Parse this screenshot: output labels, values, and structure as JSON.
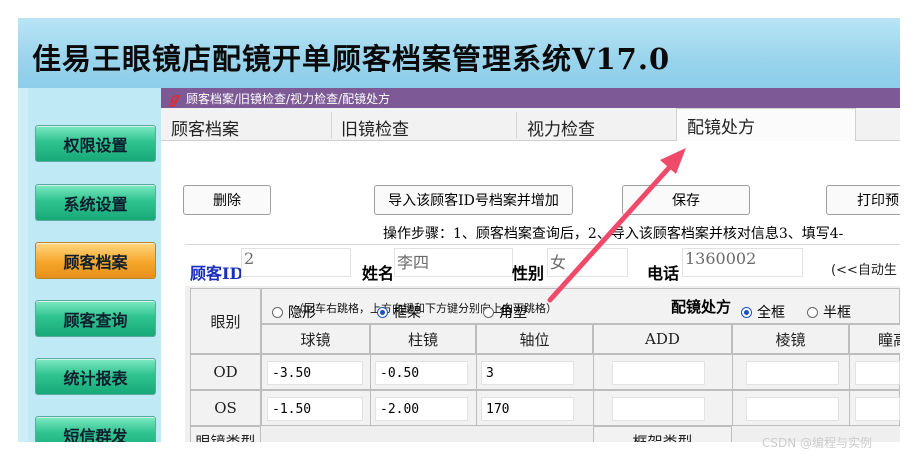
{
  "app": {
    "title": "佳易王眼镜店配镜开单顾客档案管理系统V17.0"
  },
  "sidebar": {
    "items": [
      {
        "label": "权限设置",
        "active": false
      },
      {
        "label": "系统设置",
        "active": false
      },
      {
        "label": "顾客档案",
        "active": true
      },
      {
        "label": "顾客查询",
        "active": false
      },
      {
        "label": "统计报表",
        "active": false
      },
      {
        "label": "短信群发",
        "active": false
      }
    ]
  },
  "window": {
    "title": "顾客档案/旧镜检查/视力检查/配镜处方"
  },
  "tabs": [
    {
      "label": "顾客档案"
    },
    {
      "label": "旧镜检查"
    },
    {
      "label": "视力检查"
    },
    {
      "label": "配镜处方",
      "active": true
    }
  ],
  "toolbar": {
    "delete_label": "删除",
    "import_label": "导入该顾客ID号档案并增加",
    "save_label": "保存",
    "print_label": "打印预"
  },
  "steps_text": "操作步骤：1、顾客档案查询后，2、导入该顾客档案并核对信息3、填写4-",
  "customer": {
    "id_label": "顾客ID",
    "id_value": "2",
    "name_label": "姓名",
    "name_value": "李四",
    "gender_label": "性别",
    "gender_value": "女",
    "phone_label": "电话",
    "phone_value": "1360002",
    "auto_hint": "(<<自动生"
  },
  "prescription": {
    "hint": "（回车右跳格，上方向键和下方键分别向上向下跳格）",
    "title": "配镜处方",
    "eye_header": "眼别",
    "columns": [
      "球镜",
      "柱镜",
      "轴位",
      "ADD",
      "棱镜",
      "瞳高"
    ],
    "rows": [
      {
        "eye": "OD",
        "sph": "-3.50",
        "cyl": "-0.50",
        "axis": "3"
      },
      {
        "eye": "OS",
        "sph": "-1.50",
        "cyl": "-2.00",
        "axis": "170"
      }
    ],
    "lens_type_label": "眼镜类型",
    "lens_types": [
      {
        "label": "隐形",
        "checked": false
      },
      {
        "label": "框架",
        "checked": true
      },
      {
        "label": "角塑",
        "checked": false
      }
    ],
    "frame_type_label": "框架类型",
    "frame_types": [
      {
        "label": "全框",
        "checked": true
      },
      {
        "label": "半框",
        "checked": false
      }
    ]
  },
  "watermark": "CSDN @编程与实例",
  "colors": {
    "accent_arrow": "#ef4a6a",
    "title_bar": "#7d5a96",
    "nav_green": "#2fc48f",
    "nav_orange": "#f5a62a"
  }
}
